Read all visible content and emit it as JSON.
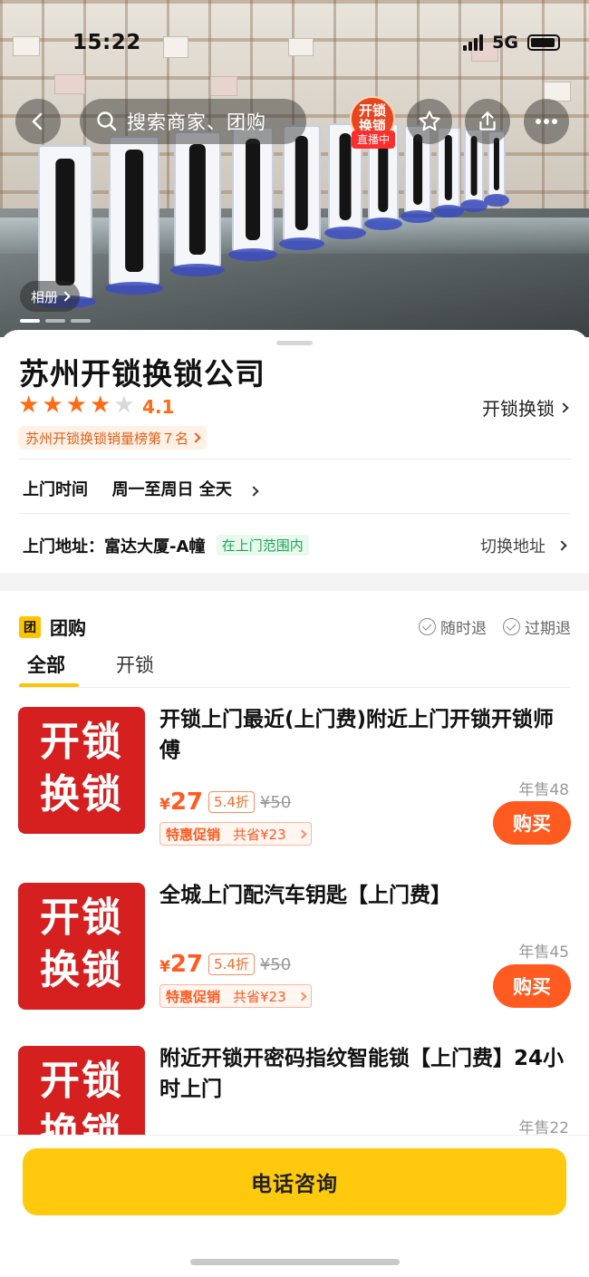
{
  "status_bar": {
    "time": "15:22",
    "network": "5G"
  },
  "header": {
    "search_placeholder": "搜索商家、团购",
    "live_badge": {
      "line1": "开锁",
      "line2": "换锁",
      "tag": "直播中"
    },
    "album_label": "相册"
  },
  "shop": {
    "name": "苏州开锁换锁公司",
    "rating": "4.1",
    "stars_filled": 4,
    "stars_total": 5,
    "category": "开锁换锁",
    "rank_tag": "苏州开锁换锁销量榜第７名",
    "service_time_label": "上门时间",
    "service_time_value": "周一至周日 全天",
    "address_label": "上门地址：",
    "address_value": "富达大厦-A幢",
    "scope_tag": "在上门范围内",
    "switch_address": "切换地址"
  },
  "group_buy": {
    "icon_text": "团",
    "title": "团购",
    "guarantees": [
      "随时退",
      "过期退"
    ],
    "tabs": [
      {
        "label": "全部",
        "active": true
      },
      {
        "label": "开锁",
        "active": false
      }
    ],
    "deals": [
      {
        "image_text": [
          "开锁",
          "换锁"
        ],
        "title": "开锁上门最近(上门费)附近上门开锁开锁师傅",
        "currency": "¥",
        "price": "27",
        "discount": "5.4折",
        "original_price": "¥50",
        "promo_label": "特惠促销",
        "promo_saving": "共省¥23",
        "sales": "年售48",
        "buy_label": "购买"
      },
      {
        "image_text": [
          "开锁",
          "换锁"
        ],
        "title": "全城上门配汽车钥匙【上门费】",
        "currency": "¥",
        "price": "27",
        "discount": "5.4折",
        "original_price": "¥50",
        "promo_label": "特惠促销",
        "promo_saving": "共省¥23",
        "sales": "年售45",
        "buy_label": "购买"
      },
      {
        "image_text": [
          "开锁",
          "换锁"
        ],
        "title": "附近开锁开密码指纹智能锁【上门费】24小时上门",
        "sales": "年售22"
      }
    ]
  },
  "bottom": {
    "call_label": "电话咨询"
  },
  "colors": {
    "accent_yellow": "#ffc300",
    "price_orange": "#ff5a1f",
    "deal_image_red": "#d61f1f",
    "scope_green": "#1ea55a"
  },
  "icons": [
    "back-icon",
    "search-icon",
    "star-outline-icon",
    "share-icon",
    "more-icon",
    "chevron-right-icon",
    "check-circle-icon"
  ]
}
